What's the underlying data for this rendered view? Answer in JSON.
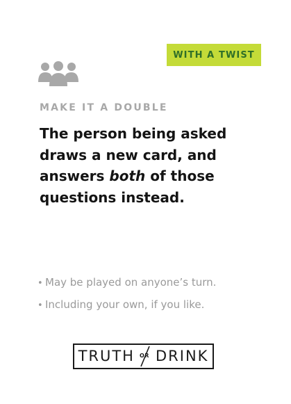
{
  "badge": {
    "label": "WITH A TWIST",
    "background": "#c4db38",
    "text_color": "#2f6f28"
  },
  "icon": {
    "name": "group-people-icon"
  },
  "card": {
    "category": "MAKE IT A DOUBLE",
    "text_part1": "The person being asked draws a new card, and answers ",
    "text_emphasis": "both",
    "text_part2": " of those questions instead."
  },
  "notes": [
    "May be played on anyone’s turn.",
    "Including your own, if you like."
  ],
  "logo": {
    "word_left": "TRUTH",
    "word_middle": "OR",
    "word_right": "DRINK"
  }
}
